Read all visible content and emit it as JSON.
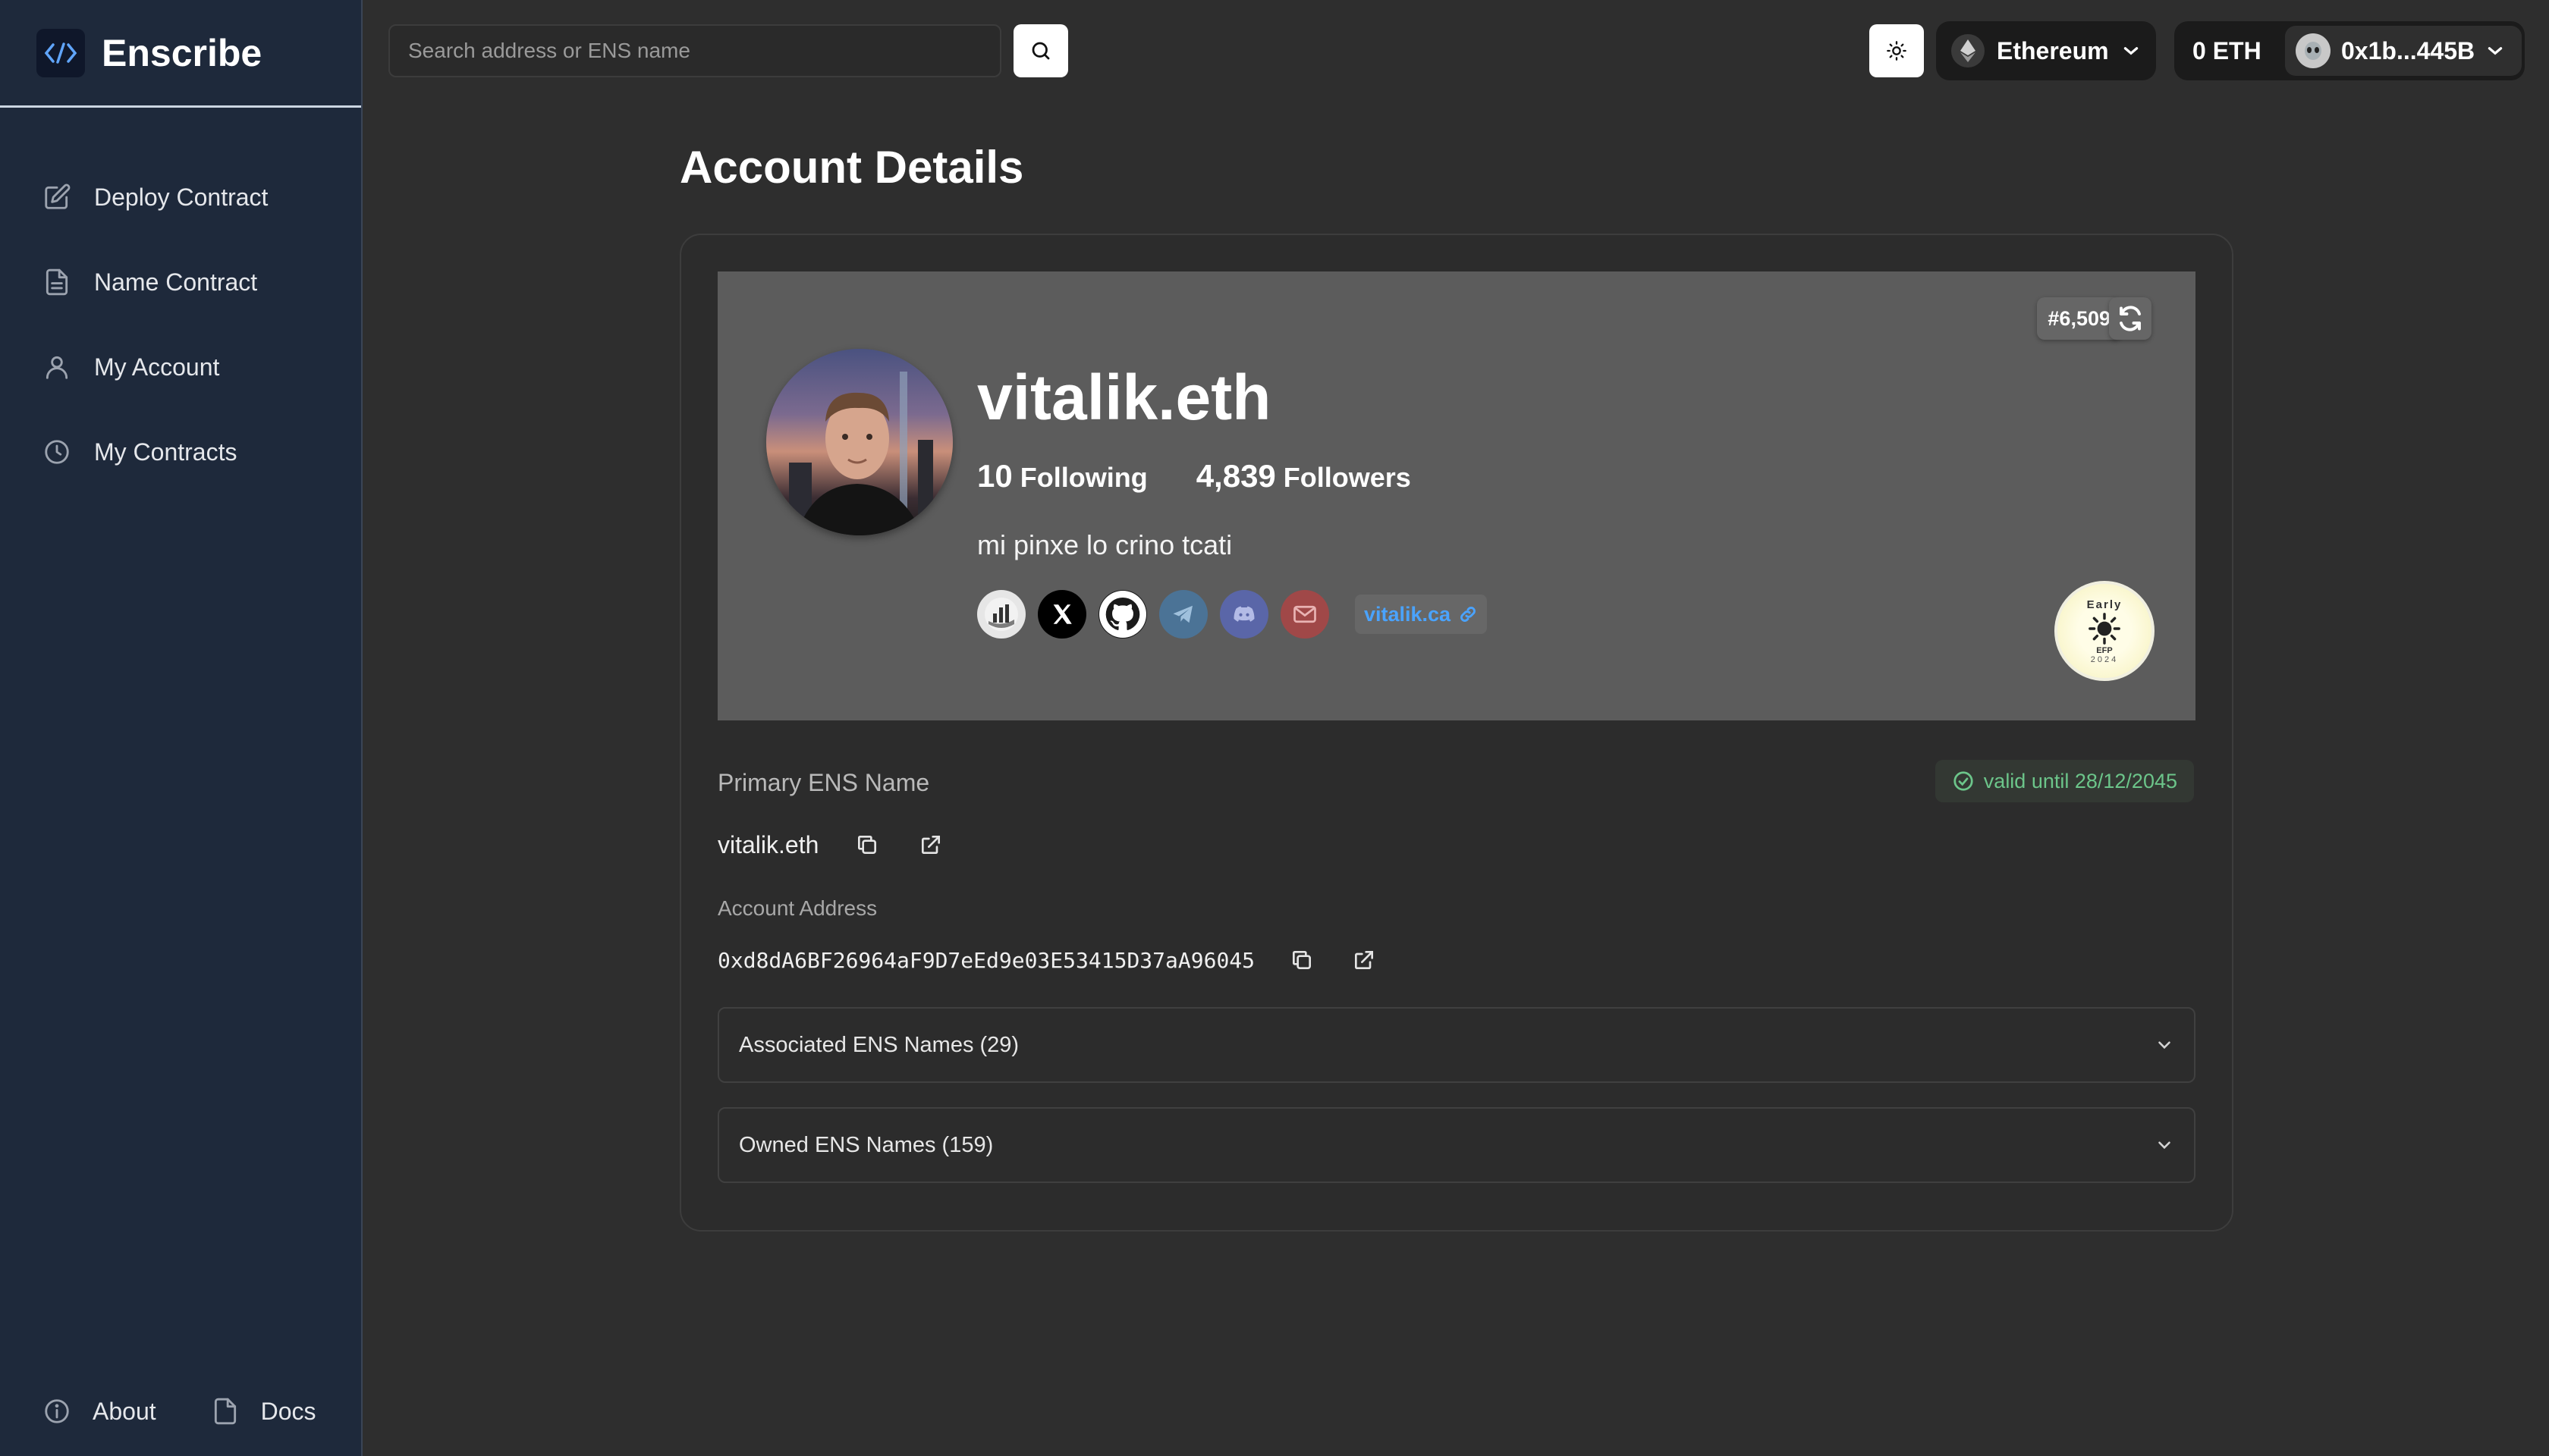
{
  "app": {
    "name": "Enscribe"
  },
  "sidebar": {
    "items": [
      {
        "label": "Deploy Contract",
        "icon": "edit-icon"
      },
      {
        "label": "Name Contract",
        "icon": "document-icon"
      },
      {
        "label": "My Account",
        "icon": "user-icon"
      },
      {
        "label": "My Contracts",
        "icon": "clock-icon"
      }
    ],
    "footer": [
      {
        "label": "About",
        "icon": "info-icon"
      },
      {
        "label": "Docs",
        "icon": "document-icon"
      }
    ]
  },
  "header": {
    "search_placeholder": "Search address or ENS name",
    "network": "Ethereum",
    "balance": "0 ETH",
    "account": "0x1b...445B"
  },
  "page": {
    "title": "Account Details"
  },
  "profile": {
    "rank": "#6,509",
    "name": "vitalik.eth",
    "following_count": "10",
    "following_label": "Following",
    "followers_count": "4,839",
    "followers_label": "Followers",
    "bio": "mi pinxe lo crino tcati",
    "website": "vitalik.ca",
    "badge_text_top": "Early",
    "badge_text_bottom": "EFP",
    "badge_year": "2024"
  },
  "details": {
    "primary_label": "Primary ENS Name",
    "primary_value": "vitalik.eth",
    "valid_until": "valid until 28/12/2045",
    "address_label": "Account Address",
    "address_value": "0xd8dA6BF26964aF9D7eEd9e03E53415D37aA96045",
    "associated_label": "Associated ENS Names (29)",
    "owned_label": "Owned ENS Names (159)"
  },
  "colors": {
    "sidebar_bg": "#1e293b",
    "page_bg": "#2e2e2e",
    "profile_bg": "#5c5c5c",
    "link": "#4aa3ff",
    "valid": "#6cc58a"
  }
}
